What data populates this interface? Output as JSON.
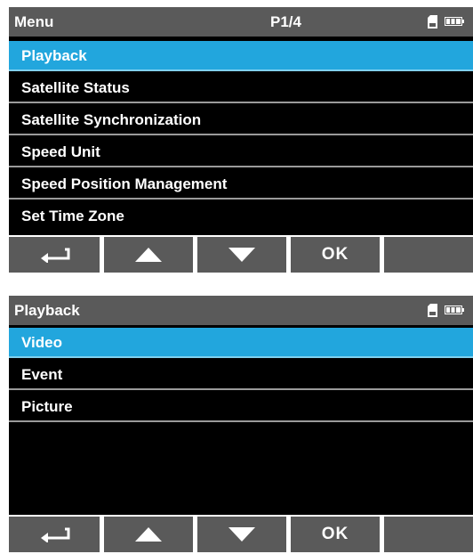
{
  "menu_screen": {
    "title": "Menu",
    "page": "P1/4",
    "status_icons": [
      "sd-card-icon",
      "battery-icon"
    ],
    "items": [
      {
        "label": "Playback",
        "selected": true
      },
      {
        "label": "Satellite Status",
        "selected": false
      },
      {
        "label": "Satellite Synchronization",
        "selected": false
      },
      {
        "label": "Speed Unit",
        "selected": false
      },
      {
        "label": "Speed Position Management",
        "selected": false
      },
      {
        "label": "Set Time Zone",
        "selected": false
      }
    ],
    "buttons": [
      {
        "icon": "back-arrow-icon"
      },
      {
        "icon": "up-arrow-icon"
      },
      {
        "icon": "down-arrow-icon"
      },
      {
        "label": "OK"
      },
      {
        "icon": ""
      }
    ]
  },
  "playback_screen": {
    "title": "Playback",
    "status_icons": [
      "sd-card-icon",
      "battery-icon"
    ],
    "items": [
      {
        "label": "Video",
        "selected": true
      },
      {
        "label": "Event",
        "selected": false
      },
      {
        "label": "Picture",
        "selected": false
      }
    ],
    "buttons": [
      {
        "icon": "back-arrow-icon"
      },
      {
        "icon": "up-arrow-icon"
      },
      {
        "icon": "down-arrow-icon"
      },
      {
        "label": "OK"
      },
      {
        "icon": ""
      }
    ]
  },
  "colors": {
    "header": "#5a5a5a",
    "selected": "#22a6dd",
    "background": "#000000"
  }
}
